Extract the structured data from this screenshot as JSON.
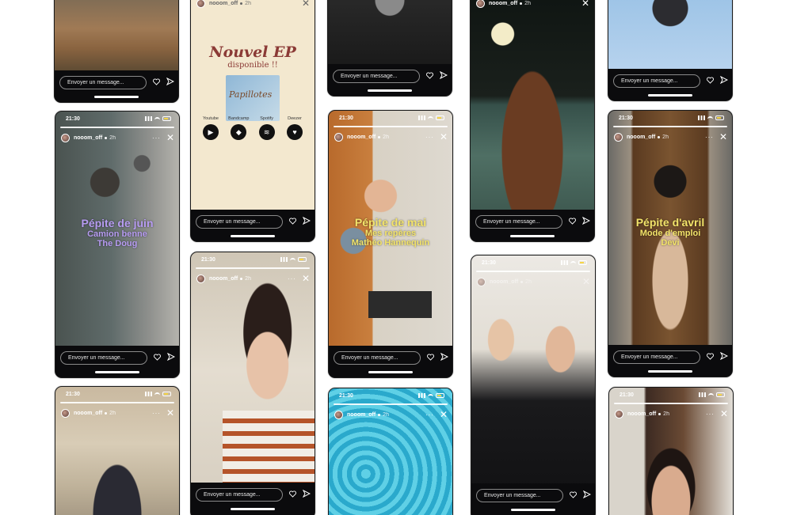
{
  "status": {
    "time": "21:30"
  },
  "story": {
    "username": "nooom_off",
    "age": "2h",
    "more": "···",
    "close": "✕",
    "reply_placeholder": "Envoyer un message...",
    "heart_icon": "heart-icon",
    "send_icon": "send-icon"
  },
  "ep_story": {
    "title": "Nouvel EP",
    "subtitle": "disponible !!",
    "album_text": "Papillotes",
    "platforms": [
      "Youtube",
      "Bandcamp",
      "Spotify",
      "Deezer"
    ]
  },
  "pepite_juin": {
    "title": "Pépite de juin",
    "artist1": "Camion benne",
    "artist2": "The Doug"
  },
  "pepite_mai": {
    "title": "Pépite de mai",
    "artist1": "Mes repères",
    "artist2": "Mathéo Hannequin"
  },
  "pepite_avril": {
    "title": "Pépite d'avril",
    "artist1": "Mode d'emploi",
    "artist2": "Devi"
  },
  "colors": {
    "overlay_yellow": "#f3e46a",
    "overlay_purple": "#b79cf2",
    "ep_red": "#8b3a36",
    "ep_bg": "#f3e8cf"
  }
}
